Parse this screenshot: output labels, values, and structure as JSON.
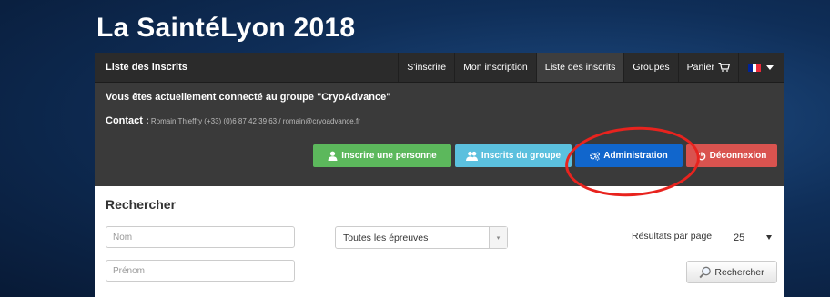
{
  "page": {
    "title": "La SaintéLyon 2018"
  },
  "navbar": {
    "brand": "Liste des inscrits",
    "items": [
      {
        "label": "S'inscrire"
      },
      {
        "label": "Mon inscription"
      },
      {
        "label": "Liste des inscrits"
      },
      {
        "label": "Groupes"
      },
      {
        "label": "Panier"
      }
    ],
    "cart_icon": "cart-icon",
    "language": {
      "icon": "french-flag-icon",
      "flag_colors": [
        "#002395",
        "#ffffff",
        "#ed2939"
      ]
    }
  },
  "info": {
    "group_line": "Vous êtes actuellement connecté au groupe \"CryoAdvance\"",
    "contact_label": "Contact :",
    "contact_value": "Romain Thieffry (+33) (0)6 87 42 39 63 / romain@cryoadvance.fr"
  },
  "actions": {
    "register_person": {
      "label": "Inscrire une personne",
      "icon": "user-add-icon",
      "color": "#5cb85c"
    },
    "group_members": {
      "label": "Inscrits du groupe",
      "icon": "users-icon",
      "color": "#5bc0de"
    },
    "administration": {
      "label": "Administration",
      "icon": "cogs-icon",
      "color": "#1166cc"
    },
    "logout": {
      "label": "Déconnexion",
      "icon": "power-icon",
      "color": "#d9534f"
    }
  },
  "search": {
    "title": "Rechercher",
    "name_placeholder": "Nom",
    "firstname_placeholder": "Prénom",
    "event_select": "Toutes les épreuves",
    "per_page_label": "Résultats par page",
    "per_page_value": "25",
    "button_label": "Rechercher",
    "button_icon": "magnifier-icon"
  },
  "annotation": {
    "color": "#e8231e"
  }
}
